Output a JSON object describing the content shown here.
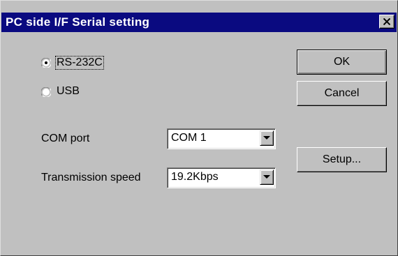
{
  "window": {
    "title": "PC side I/F  Serial setting"
  },
  "interface": {
    "options": [
      {
        "label": "RS-232C",
        "selected": true
      },
      {
        "label": "USB",
        "selected": false
      }
    ]
  },
  "settings": {
    "com_port": {
      "label": "COM port",
      "value": "COM 1"
    },
    "transmission_speed": {
      "label": "Transmission speed",
      "value": "19.2Kbps"
    }
  },
  "buttons": {
    "ok": "OK",
    "cancel": "Cancel",
    "setup": "Setup..."
  },
  "icons": {
    "close": "close-icon",
    "dropdown": "chevron-down-icon"
  },
  "colors": {
    "titlebar": "#0a0a80",
    "face": "#c0c0c0"
  }
}
